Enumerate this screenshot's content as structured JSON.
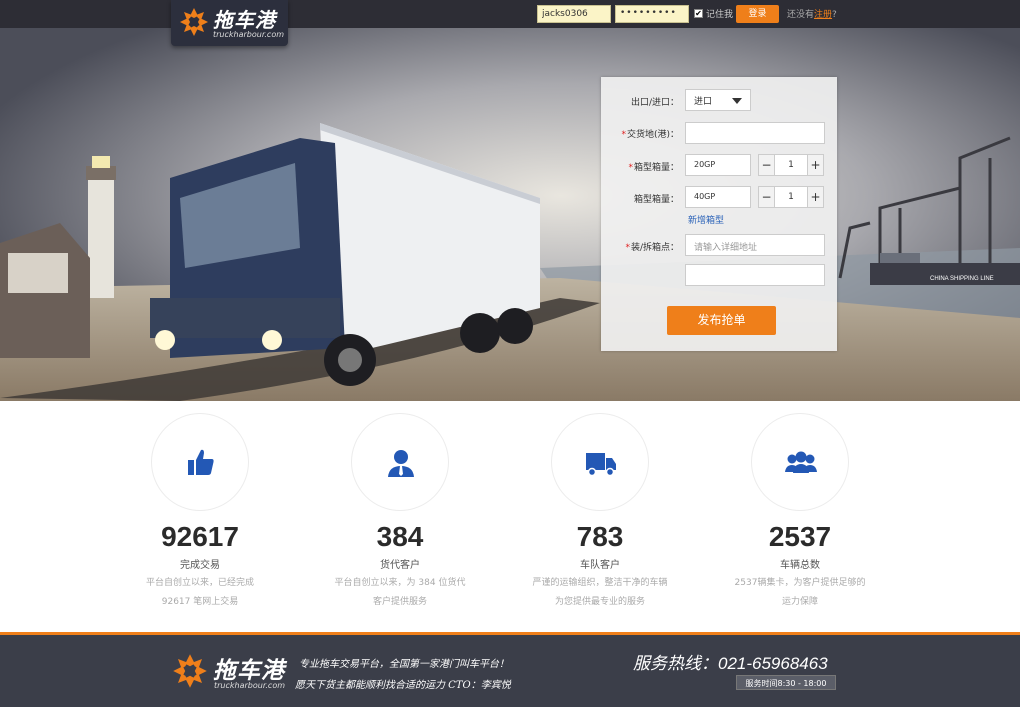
{
  "brand": {
    "name": "拖车港",
    "sub": "truckharbour.com",
    "accent": "#ef7f1a"
  },
  "login": {
    "username": "jacks0306",
    "password": "•••••••••",
    "remember_checked": "✔",
    "remember_label": "记住我",
    "login_button": "登录",
    "register_prefix": "还没有",
    "register_link": "注册",
    "register_suffix": "?"
  },
  "form": {
    "direction_label": "出口/进口：",
    "direction_value": "进口",
    "delivery_label": "交货地(港)：",
    "box1_label": "箱型箱量：",
    "box1_type": "20GP",
    "box1_qty": "1",
    "box2_label": "箱型箱量：",
    "box2_type": "40GP",
    "box2_qty": "1",
    "add_box": "新增箱型",
    "address_label": "装/拆箱点：",
    "address_placeholder": "请输入详细地址",
    "submit": "发布抢单",
    "minus": "−",
    "plus": "+"
  },
  "hero_text": {
    "truck_plate": "CHINA SHIPPING LINE"
  },
  "stats": [
    {
      "icon": "thumbs-up-icon",
      "number": "92617",
      "title": "完成交易",
      "desc1": "平台自创立以来，已经完成",
      "desc2": "92617 笔网上交易"
    },
    {
      "icon": "user-icon",
      "number": "384",
      "title": "货代客户",
      "desc1": "平台自创立以来，为 384 位货代",
      "desc2": "客户提供服务"
    },
    {
      "icon": "truck-icon",
      "number": "783",
      "title": "车队客户",
      "desc1": "严谨的运输组织，整洁干净的车辆",
      "desc2": "为您提供最专业的服务"
    },
    {
      "icon": "group-icon",
      "number": "2537",
      "title": "车辆总数",
      "desc1": "2537辆集卡，为客户提供足够的",
      "desc2": "运力保障"
    }
  ],
  "footer": {
    "brand": "拖车港",
    "sub": "truckharbour.com",
    "slogan": "专业拖车交易平台，全国第一家港门叫车平台！",
    "signature": "愿天下货主都能顺利找合适的运力   CTO：李宾悦",
    "hotline": "服务热线：021-65968463",
    "hours": "服务时间8:30 - 18:00"
  }
}
